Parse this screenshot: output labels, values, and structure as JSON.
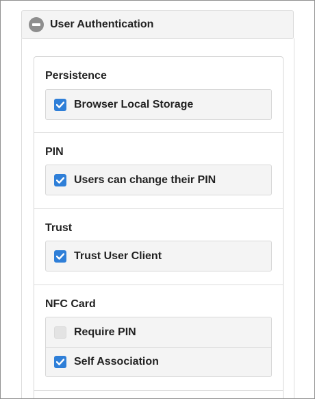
{
  "header": {
    "title": "User Authentication",
    "icon": "collapse-icon"
  },
  "sections": [
    {
      "title": "Persistence",
      "options": [
        {
          "label": "Browser Local Storage",
          "checked": true
        }
      ]
    },
    {
      "title": "PIN",
      "options": [
        {
          "label": "Users can change their PIN",
          "checked": true
        }
      ]
    },
    {
      "title": "Trust",
      "options": [
        {
          "label": "Trust User Client",
          "checked": true
        }
      ]
    },
    {
      "title": "NFC Card",
      "options": [
        {
          "label": "Require PIN",
          "checked": false
        },
        {
          "label": "Self Association",
          "checked": true
        }
      ]
    }
  ],
  "colors": {
    "checkbox_checked": "#2f7fd8",
    "header_bg": "#f4f4f4"
  }
}
